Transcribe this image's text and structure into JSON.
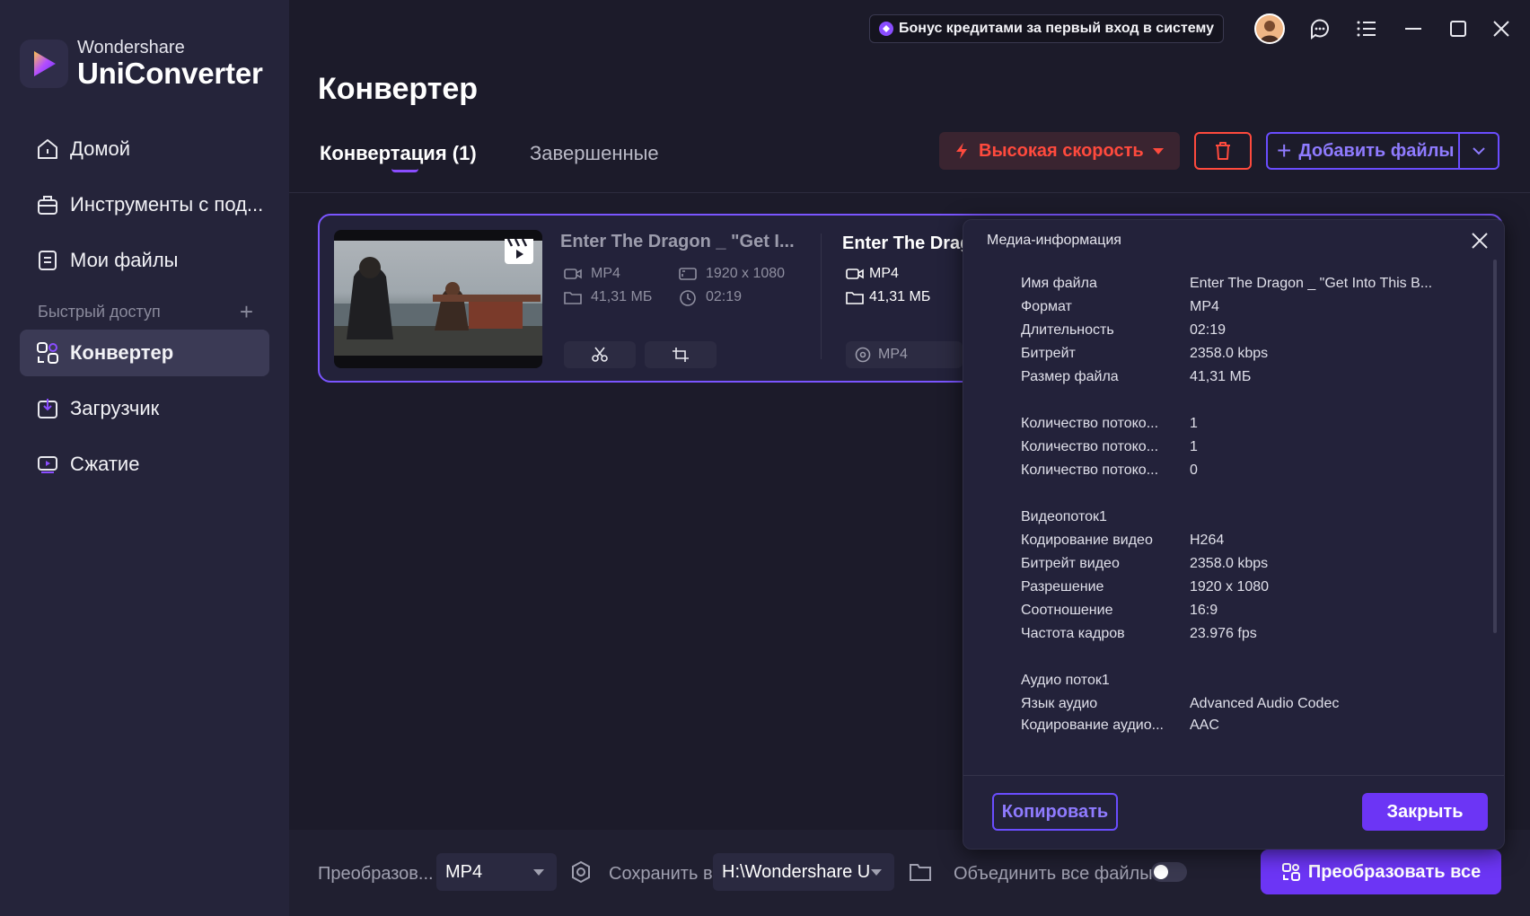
{
  "app": {
    "brand_sub": "Wondershare",
    "brand_main": "UniConverter",
    "accent": "#6c35f5",
    "danger": "#ff4a3d"
  },
  "titlebar": {
    "bonus": "Бонус кредитами за первый вход в систему",
    "icons": [
      "avatar",
      "chat-icon",
      "menu-icon",
      "minimize-icon",
      "maximize-icon",
      "close-icon"
    ]
  },
  "sidebar": {
    "items": [
      {
        "label": "Домой",
        "icon": "home-icon"
      },
      {
        "label": "Инструменты с под...",
        "icon": "toolbox-icon"
      },
      {
        "label": "Мои файлы",
        "icon": "files-icon"
      }
    ],
    "quick_access": "Быстрый доступ",
    "quick_items": [
      {
        "label": "Конвертер",
        "icon": "converter-icon",
        "active": true
      },
      {
        "label": "Загрузчик",
        "icon": "download-icon"
      },
      {
        "label": "Сжатие",
        "icon": "compress-icon"
      }
    ]
  },
  "main": {
    "title": "Конвертер",
    "tabs": [
      {
        "label": "Конвертация (1)",
        "active": true
      },
      {
        "label": "Завершенные",
        "active": false
      }
    ],
    "speed_button": "Высокая скорость",
    "add_button": "Добавить файлы"
  },
  "file": {
    "src_title": "Enter The Dragon _ \"Get I...",
    "src_format": "MP4",
    "src_resolution": "1920 x 1080",
    "src_size": "41,31 МБ",
    "src_duration": "02:19",
    "dst_title": "Enter The Drag",
    "dst_format": "MP4",
    "dst_size": "41,31 МБ",
    "dst_target_format": "MP4"
  },
  "bottom": {
    "convert_label": "Преобразов...",
    "convert_value": "MP4",
    "save_label": "Сохранить в",
    "save_value": "H:\\Wondershare Ur",
    "merge_label": "Объединить все файлы",
    "merge_on": false,
    "convert_all": "Преобразовать все"
  },
  "media_info": {
    "title": "Медиа-информация",
    "general": [
      {
        "k": "Имя файла",
        "v": "Enter The Dragon _ \"Get Into This B..."
      },
      {
        "k": "Формат",
        "v": "MP4"
      },
      {
        "k": "Длительность",
        "v": "02:19"
      },
      {
        "k": "Битрейт",
        "v": "2358.0 kbps"
      },
      {
        "k": "Размер файла",
        "v": "41,31 МБ"
      }
    ],
    "streams": [
      {
        "k": "Количество потоко...",
        "v": "1"
      },
      {
        "k": "Количество потоко...",
        "v": "1"
      },
      {
        "k": "Количество потоко...",
        "v": "0"
      }
    ],
    "video_head": "Видеопоток1",
    "video": [
      {
        "k": "Кодирование видео",
        "v": "H264"
      },
      {
        "k": "Битрейт видео",
        "v": "2358.0 kbps"
      },
      {
        "k": "Разрешение",
        "v": "1920 x 1080"
      },
      {
        "k": "Соотношение",
        "v": "16:9"
      },
      {
        "k": "Частота кадров",
        "v": "23.976 fps"
      }
    ],
    "audio_head": "Аудио поток1",
    "audio": [
      {
        "k": "Язык аудио",
        "v": "Advanced Audio Codec"
      },
      {
        "k": "Кодирование аудио...",
        "v": "AAC"
      }
    ],
    "copy_button": "Копировать",
    "close_button": "Закрыть"
  }
}
